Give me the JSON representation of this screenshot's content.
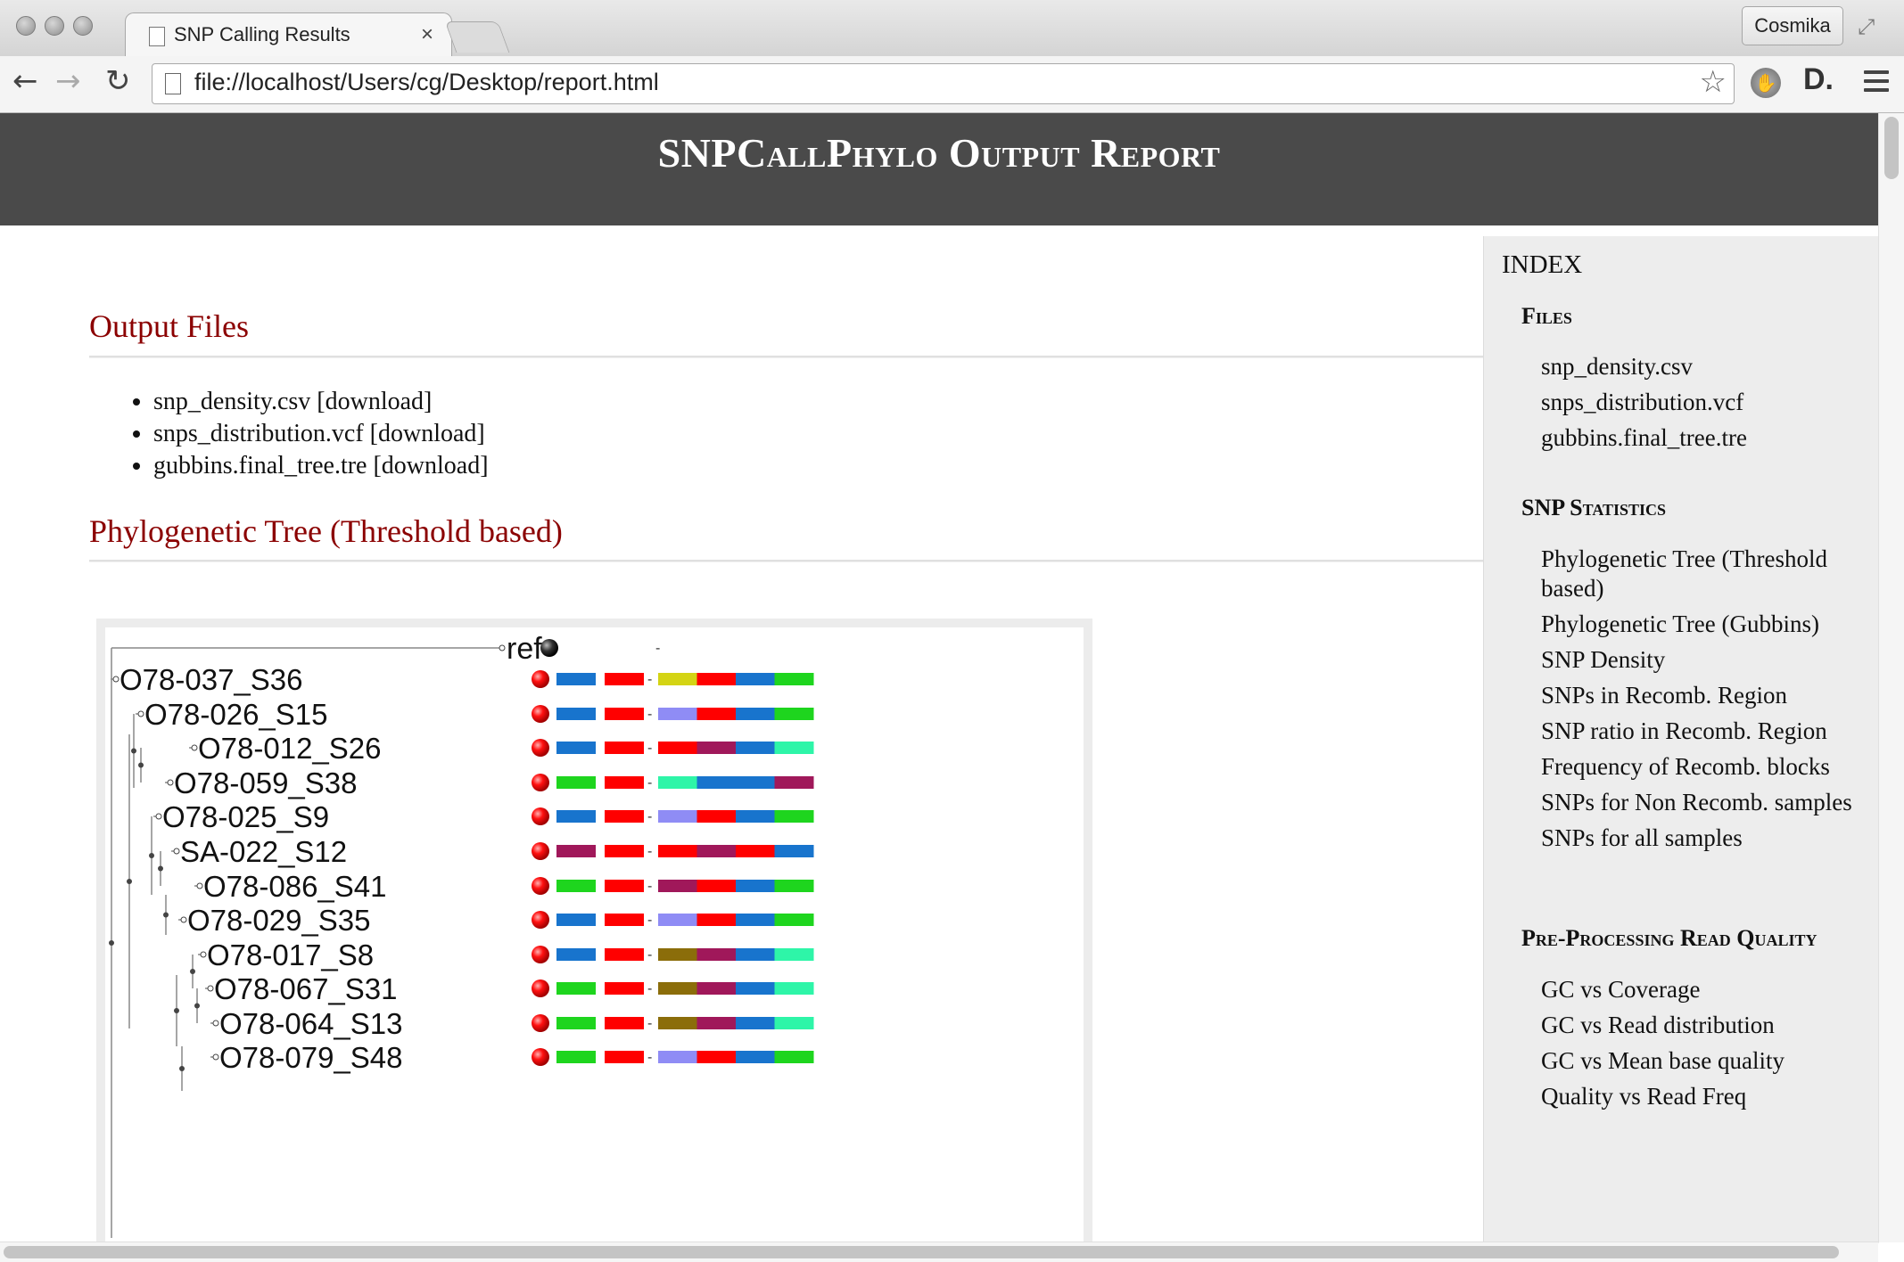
{
  "browser": {
    "tab_title": "SNP Calling Results",
    "tab_close": "×",
    "url": "file://localhost/Users/cg/Desktop/report.html",
    "profile_name": "Cosmika",
    "icons": [
      "back-icon",
      "forward-icon",
      "reload-icon",
      "star-icon",
      "hand-extension-icon",
      "d-extension-icon",
      "menu-icon",
      "fullscreen-icon"
    ]
  },
  "header": {
    "title": "SNPCallPhylo Output Report"
  },
  "output_files": {
    "heading": "Output Files",
    "files": [
      "snp_density.csv [download]",
      "snps_distribution.vcf [download]",
      "gubbins.final_tree.tre [download]"
    ]
  },
  "phylo_section": {
    "heading": "Phylogenetic Tree (Threshold based)"
  },
  "tree": {
    "colors": {
      "blue": "#1874cd",
      "red": "#ff0000",
      "green": "#1ed51e",
      "yellow": "#d4d414",
      "lavender": "#8f8cf5",
      "maroon": "#a0185a",
      "mint": "#2ef5a8",
      "olive": "#8b6d0a"
    },
    "ref": {
      "label": "ref",
      "dash": "-"
    },
    "leaves": [
      {
        "label": "O78-037_S36",
        "b1": "blue",
        "b2": "red",
        "segs": [
          "yellow",
          "red",
          "blue",
          "green"
        ]
      },
      {
        "label": "O78-026_S15",
        "b1": "blue",
        "b2": "red",
        "segs": [
          "lavender",
          "red",
          "blue",
          "green"
        ]
      },
      {
        "label": "O78-012_S26",
        "b1": "blue",
        "b2": "red",
        "segs": [
          "red",
          "maroon",
          "blue",
          "mint"
        ]
      },
      {
        "label": "O78-059_S38",
        "b1": "green",
        "b2": "red",
        "segs": [
          "mint",
          "blue",
          "blue",
          "maroon"
        ]
      },
      {
        "label": "O78-025_S9",
        "b1": "blue",
        "b2": "red",
        "segs": [
          "lavender",
          "red",
          "blue",
          "green"
        ]
      },
      {
        "label": "SA-022_S12",
        "b1": "maroon",
        "b2": "red",
        "segs": [
          "red",
          "maroon",
          "red",
          "blue"
        ]
      },
      {
        "label": "O78-086_S41",
        "b1": "green",
        "b2": "red",
        "segs": [
          "maroon",
          "red",
          "blue",
          "green"
        ]
      },
      {
        "label": "O78-029_S35",
        "b1": "blue",
        "b2": "red",
        "segs": [
          "lavender",
          "red",
          "blue",
          "green"
        ]
      },
      {
        "label": "O78-017_S8",
        "b1": "blue",
        "b2": "red",
        "segs": [
          "olive",
          "maroon",
          "blue",
          "mint"
        ]
      },
      {
        "label": "O78-067_S31",
        "b1": "green",
        "b2": "red",
        "segs": [
          "olive",
          "maroon",
          "blue",
          "mint"
        ]
      },
      {
        "label": "O78-064_S13",
        "b1": "green",
        "b2": "red",
        "segs": [
          "olive",
          "maroon",
          "blue",
          "mint"
        ]
      },
      {
        "label": "O78-079_S48",
        "b1": "green",
        "b2": "red",
        "segs": [
          "lavender",
          "red",
          "blue",
          "green"
        ]
      }
    ]
  },
  "sidebar": {
    "title": "INDEX",
    "sections": [
      {
        "heading": "Files",
        "items": [
          "snp_density.csv",
          "snps_distribution.vcf",
          "gubbins.final_tree.tre"
        ]
      },
      {
        "heading": "SNP Statistics",
        "items": [
          "Phylogenetic Tree (Threshold based)",
          "Phylogenetic Tree (Gubbins)",
          "SNP Density",
          "SNPs in Recomb. Region",
          "SNP ratio in Recomb. Region",
          "Frequency of Recomb. blocks",
          "SNPs for Non Recomb. samples",
          "SNPs for all samples"
        ]
      },
      {
        "heading": "Pre-Processing Read Quality",
        "items": [
          "GC vs Coverage",
          "GC vs Read distribution",
          "GC vs Mean base quality",
          "Quality vs Read Freq"
        ]
      }
    ]
  }
}
